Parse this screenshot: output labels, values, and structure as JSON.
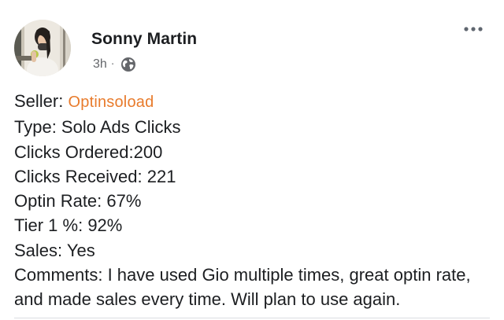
{
  "post": {
    "author": "Sonny Martin",
    "timestamp": "3h",
    "separator": "·",
    "visibility_icon": "globe-icon",
    "more_icon": "more-options-icon"
  },
  "review": {
    "seller_label": "Seller:",
    "seller_name": "Optinsoload",
    "type": "Type: Solo Ads Clicks",
    "clicks_ordered": "Clicks Ordered:200",
    "clicks_received": "Clicks Received: 221",
    "optin_rate": "Optin Rate: 67%",
    "tier1": "Tier 1 %: 92%",
    "sales": "Sales: Yes",
    "comments": "Comments: I have used Gio multiple times, great optin rate, and made sales every time. Will plan to use again."
  },
  "colors": {
    "seller_link": "#e87b2c",
    "text": "#1c1e21",
    "meta": "#65676b"
  }
}
